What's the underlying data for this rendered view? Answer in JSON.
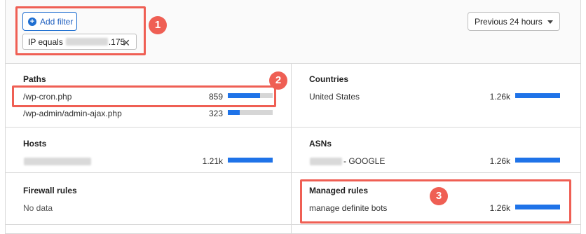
{
  "toolbar": {
    "add_filter_label": "Add filter",
    "filter_chip": {
      "prefix": "IP equals",
      "suffix": ".175"
    },
    "time_range": "Previous 24 hours"
  },
  "cards": {
    "paths": {
      "title": "Paths",
      "rows": [
        {
          "label": "/wp-cron.php",
          "value": "859",
          "fill": 0.72
        },
        {
          "label": "/wp-admin/admin-ajax.php",
          "value": "323",
          "fill": 0.27
        }
      ]
    },
    "countries": {
      "title": "Countries",
      "rows": [
        {
          "label": "United States",
          "value": "1.26k",
          "fill": 1.0
        }
      ]
    },
    "hosts": {
      "title": "Hosts",
      "rows": [
        {
          "label": "",
          "value": "1.21k",
          "fill": 1.0
        }
      ]
    },
    "asns": {
      "title": "ASNs",
      "rows": [
        {
          "label": "- GOOGLE",
          "value": "1.26k",
          "fill": 1.0
        }
      ]
    },
    "firewall": {
      "title": "Firewall rules",
      "empty": "No data"
    },
    "managed": {
      "title": "Managed rules",
      "rows": [
        {
          "label": "manage definite bots",
          "value": "1.26k",
          "fill": 1.0
        }
      ]
    }
  },
  "callouts": {
    "one": "1",
    "two": "2",
    "three": "3"
  },
  "colors": {
    "accent": "#1f73e8",
    "callout": "#ef5f54"
  }
}
